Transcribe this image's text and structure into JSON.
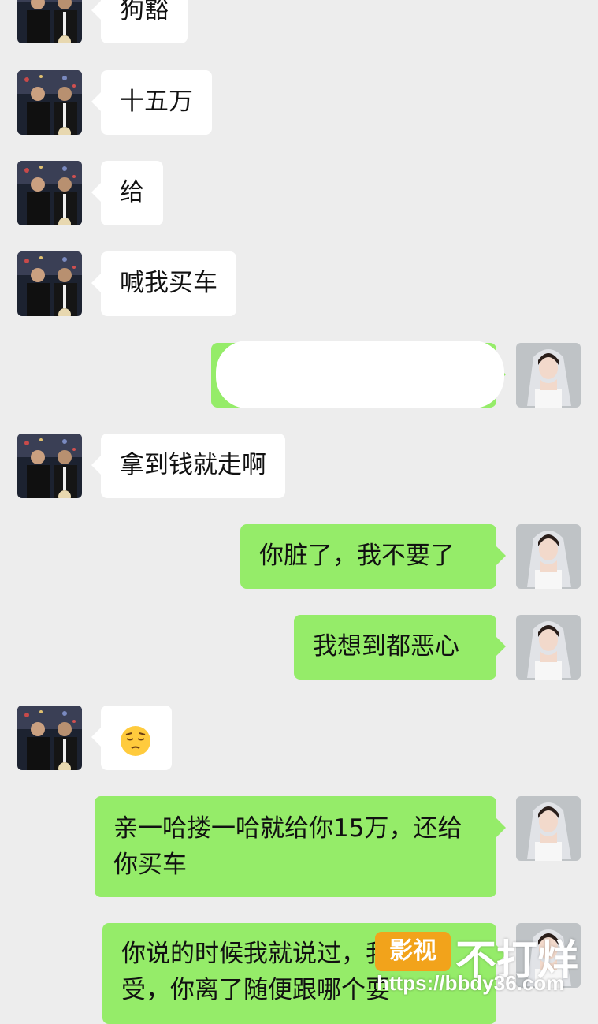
{
  "messages": [
    {
      "side": "in",
      "text": "狗豁"
    },
    {
      "side": "in",
      "text": "十五万"
    },
    {
      "side": "in",
      "text": "给"
    },
    {
      "side": "in",
      "text": "喊我买车"
    },
    {
      "side": "out",
      "text": ""
    },
    {
      "side": "in",
      "text": "拿到钱就走啊"
    },
    {
      "side": "out",
      "text": "你脏了，我不要了"
    },
    {
      "side": "out",
      "text": "我想到都恶心"
    },
    {
      "side": "in",
      "text": "",
      "emoji": "pensive-face-emoji"
    },
    {
      "side": "out",
      "text": "亲一哈搂一哈就给你15万，还给你买车"
    },
    {
      "side": "out",
      "text": "你说的时候我就说过，我不接受，你离了随便跟哪个耍"
    }
  ],
  "watermark": {
    "badge": "影视",
    "title": "不打烊",
    "url": "https://bbdy36.com"
  },
  "colors": {
    "background": "#ededed",
    "incoming_bubble": "#ffffff",
    "outgoing_bubble": "#95ec69",
    "watermark_badge": "#f2a31b"
  }
}
